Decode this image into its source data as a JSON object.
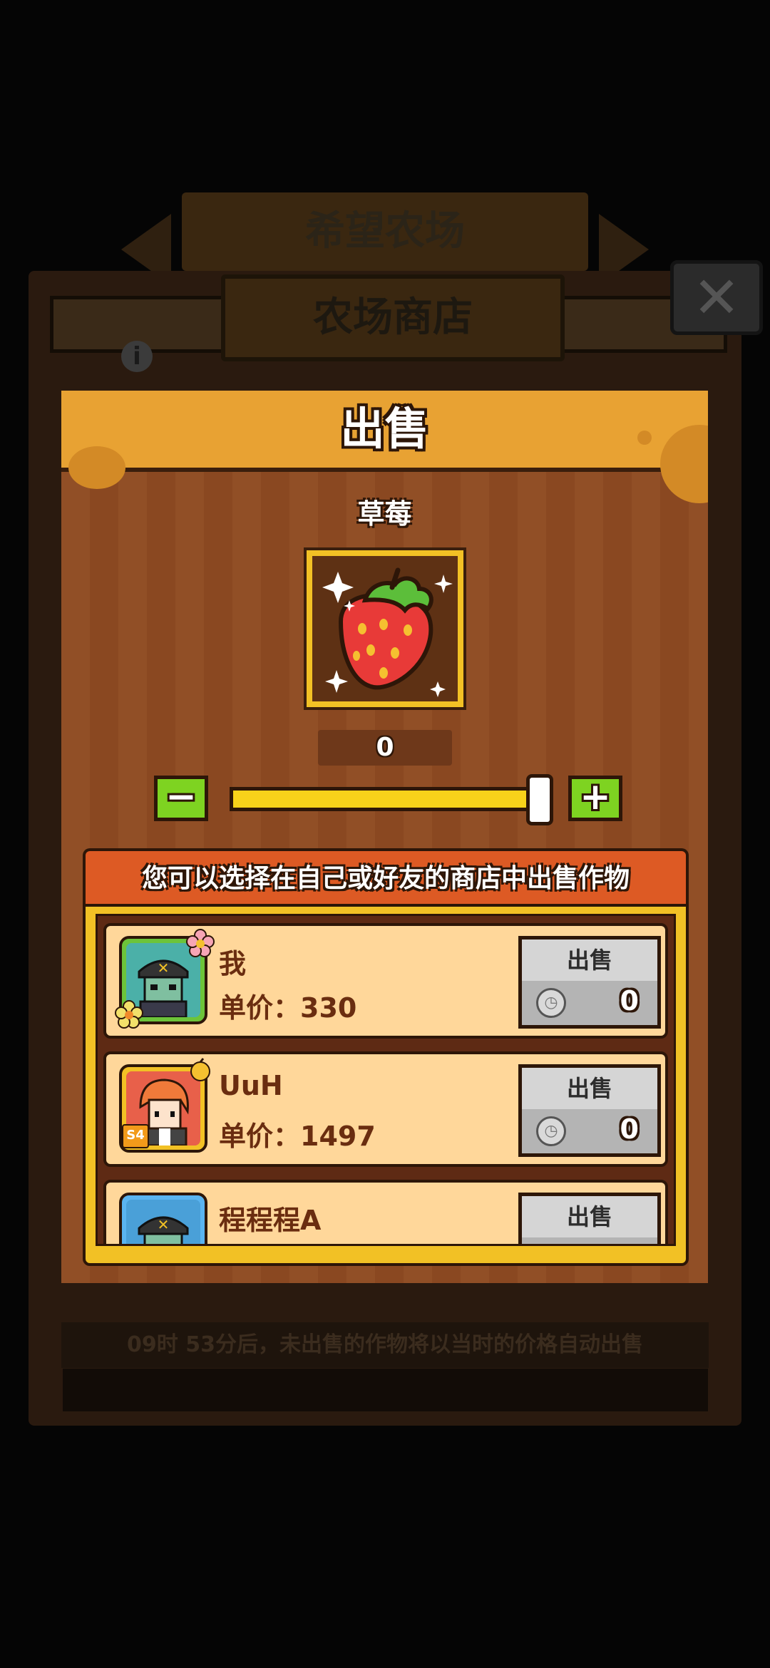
{
  "background": {
    "farm_title": "希望农场",
    "shop_title": "农场商店",
    "close_symbol": "✕",
    "info_symbol": "i",
    "footer_notice": "09时 53分后，未出售的作物将以当时的价格自动出售"
  },
  "modal": {
    "title": "出售",
    "crop_name": "草莓",
    "crop_icon": "strawberry-icon",
    "quantity": "0",
    "slider": {
      "value_fraction": 1.0
    },
    "minus_symbol": "−",
    "plus_symbol": "+",
    "hint": "您可以选择在自己或好友的商店中出售作物",
    "shops": [
      {
        "name": "我",
        "price_label": "单价：330",
        "sell_label": "出售",
        "sell_value": "0",
        "avatar_border": "#6cc43a"
      },
      {
        "name": "UuH",
        "price_label": "单价：1497",
        "sell_label": "出售",
        "sell_value": "0",
        "avatar_border": "#f2c125",
        "badge": "S4"
      },
      {
        "name": "程程程A",
        "price_label": "",
        "sell_label": "出售",
        "sell_value": "",
        "avatar_border": "#5ab4f0"
      }
    ]
  },
  "colors": {
    "header": "#e8a233",
    "banner": "#dd5a24",
    "row_bg": "#ffd79a",
    "green_button": "#7ed321",
    "slider": "#f8d21a"
  }
}
